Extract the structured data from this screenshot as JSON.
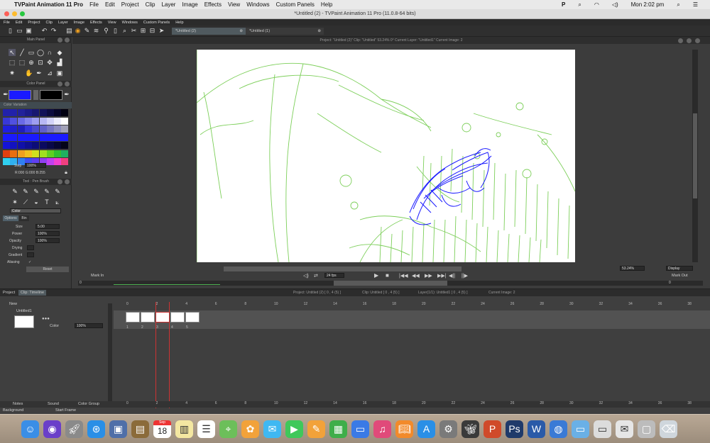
{
  "macos_menubar": {
    "app_name": "TVPaint Animation 11 Pro",
    "menus": [
      "File",
      "Edit",
      "Project",
      "Clip",
      "Layer",
      "Image",
      "Effects",
      "View",
      "Windows",
      "Custom Panels",
      "Help"
    ],
    "clock": "Mon 2:02 pm"
  },
  "window": {
    "title": "*Untitled (2) - TVPaint Animation 11 Pro (11.0.8-64 bits)"
  },
  "app_menu": [
    "File",
    "Edit",
    "Project",
    "Clip",
    "Layer",
    "Image",
    "Effects",
    "View",
    "Windows",
    "Custom Panels",
    "Help"
  ],
  "doc_tabs": [
    "*Untitled (2)",
    "*Untitled (1)"
  ],
  "view_header": "Project: \"Untitled (2)\"  Clip: \"Untitled\"   53.24%   0°   Current Layer: \"Untitled1\"  Current Image: 2",
  "main_panel": {
    "title": "Main Panel"
  },
  "color_panel": {
    "title": "Color Panel",
    "variation_label": "Color Variation",
    "primary_color": "#1a1aff",
    "secondary_color": "#000000",
    "step_label": "Step",
    "step_value": "100%",
    "rgb_readout": "R:000 G:000 B:255",
    "palette_rows": [
      [
        "#2222aa",
        "#2222aa",
        "#22229a",
        "#1c1c88",
        "#181870",
        "#121258",
        "#0c0c40",
        "#060628",
        "#000010"
      ],
      [
        "#3838d8",
        "#5050e0",
        "#6a6ae6",
        "#8484ec",
        "#9e9ef0",
        "#b8b8f4",
        "#d2d2f8",
        "#ececfc",
        "#ffffff"
      ],
      [
        "#1f1fdf",
        "#1f1fcc",
        "#1f1fbb",
        "#3434d6",
        "#4a4acc",
        "#6060c8",
        "#7676c2",
        "#8c8cbe",
        "#a2a2b8"
      ],
      [
        "#1a1aff",
        "#1a1aff",
        "#1a1aff",
        "#1a1aff",
        "#1a1aff",
        "#1a1aff",
        "#1a1aff",
        "#1a1aff",
        "#1a1aff"
      ],
      [
        "#1414d8",
        "#1212c0",
        "#1010a8",
        "#0e0e90",
        "#0c0c78",
        "#0a0a60",
        "#080848",
        "#060630",
        "#040418"
      ],
      [
        "#e04010",
        "#e86f10",
        "#f0a020",
        "#f0c020",
        "#d0e020",
        "#a0e020",
        "#60d020",
        "#30c030",
        "#20b060"
      ],
      [
        "#30d0f0",
        "#30b0f0",
        "#3080f0",
        "#4050f0",
        "#6040f0",
        "#9040f0",
        "#c040f0",
        "#f040d0",
        "#f04080"
      ]
    ]
  },
  "tool_panel": {
    "title": "Tool : Pen Brush",
    "mode": "Color",
    "tabs": [
      "Options",
      "Bin"
    ],
    "size_label": "Size",
    "size_value": "5.00",
    "power_label": "Power",
    "power_value": "100%",
    "opacity_label": "Opacity",
    "opacity_value": "100%",
    "drying_label": "Drying",
    "gradient_label": "Gradient",
    "aliasing_label": "Aliasing",
    "reset_label": "Reset"
  },
  "view_bottom": {
    "mark_in": "Mark In",
    "mark_out": "Mark Out",
    "in_value": "0",
    "out_value": "0",
    "fps": "24 fps",
    "zoom": "53.24%",
    "display": "Display"
  },
  "timeline": {
    "tabs": [
      "Project",
      "Clip: Timeline"
    ],
    "info": [
      "Project: Untitled (2) [ 0 , 4  (5) ]",
      "Clip: Untitled [ 0 , 4  (5) ]",
      "Layer(1/1): Untitled1 [ 0 , 4  (5) ]",
      "Current Image: 2"
    ],
    "new_label": "New",
    "layer_name": "Untitled1",
    "layer_mode": "Color",
    "layer_opacity": "100%",
    "ticks": [
      "0",
      "2",
      "4",
      "6",
      "8",
      "10",
      "12",
      "14",
      "16",
      "18",
      "20",
      "22",
      "24",
      "26",
      "28",
      "30",
      "32",
      "34",
      "36",
      "38"
    ],
    "frame_numbers": [
      "1",
      "2",
      "3",
      "4",
      "5"
    ],
    "bottom_tabs": [
      "Notes",
      "Sound",
      "Color Group"
    ],
    "background_label": "Background",
    "start_frame_label": "Start Frame"
  },
  "dock": {
    "calendar_month": "Sep",
    "calendar_day": "18",
    "apps": [
      "finder-icon",
      "siri-icon",
      "launchpad-icon",
      "safari-icon",
      "preview-icon",
      "book-icon",
      "calendar-icon",
      "notes-icon",
      "reminders-icon",
      "maps-icon",
      "photos-icon",
      "messages-icon",
      "facetime-icon",
      "pages-icon",
      "numbers-icon",
      "keynote-icon",
      "itunes-icon",
      "ibooks-icon",
      "appstore-icon",
      "system-preferences-icon",
      "tvpaint-icon",
      "powerpoint-icon",
      "photoshop-icon",
      "word-icon",
      "globe-icon",
      "folder-icon",
      "window-icon",
      "mail-preview-icon",
      "screenshot-icon",
      "trash-icon"
    ]
  },
  "colors": {
    "accent_blue": "#1a1aff",
    "sketch_green": "#7dcf5a"
  }
}
